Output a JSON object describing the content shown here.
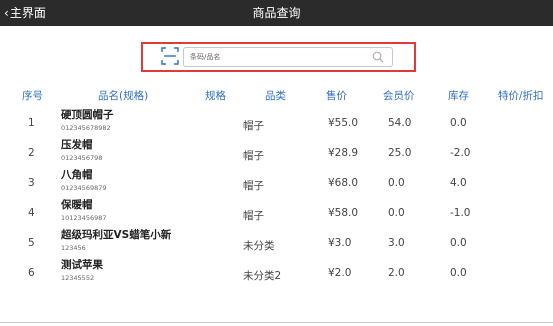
{
  "topbar": {
    "back_label": "主界面",
    "title": "商品查询"
  },
  "search": {
    "placeholder": "条码/品名",
    "value": ""
  },
  "table": {
    "headers": [
      "序号",
      "品名(规格)",
      "规格",
      "品类",
      "售价",
      "会员价",
      "库存",
      "特价/折扣"
    ],
    "rows": [
      {
        "idx": "1",
        "name": "硬顶圆帽子",
        "code": "012345678982",
        "spec": "",
        "category": "帽子",
        "price": "¥55.0",
        "member_price": "54.0",
        "stock": "0.0",
        "special": ""
      },
      {
        "idx": "2",
        "name": "压发帽",
        "code": "0123456798",
        "spec": "",
        "category": "帽子",
        "price": "¥28.9",
        "member_price": "25.0",
        "stock": "-2.0",
        "special": ""
      },
      {
        "idx": "3",
        "name": "八角帽",
        "code": "01234569879",
        "spec": "",
        "category": "帽子",
        "price": "¥68.0",
        "member_price": "0.0",
        "stock": "4.0",
        "special": ""
      },
      {
        "idx": "4",
        "name": "保暖帽",
        "code": "10123456987",
        "spec": "",
        "category": "帽子",
        "price": "¥58.0",
        "member_price": "0.0",
        "stock": "-1.0",
        "special": ""
      },
      {
        "idx": "5",
        "name": "超级玛利亚VS蜡笔小新",
        "code": "123456",
        "spec": "",
        "category": "未分类",
        "price": "¥3.0",
        "member_price": "3.0",
        "stock": "0.0",
        "special": ""
      },
      {
        "idx": "6",
        "name": "测试苹果",
        "code": "12345552",
        "spec": "",
        "category": "未分类2",
        "price": "¥2.0",
        "member_price": "2.0",
        "stock": "0.0",
        "special": ""
      }
    ]
  },
  "colors": {
    "topbar": "#2b2b2b",
    "header_text": "#2f6fc4",
    "highlight": "#e03a3a"
  },
  "icons": {
    "back": "chevron-left-icon",
    "scan": "scan-icon",
    "search": "search-icon"
  }
}
